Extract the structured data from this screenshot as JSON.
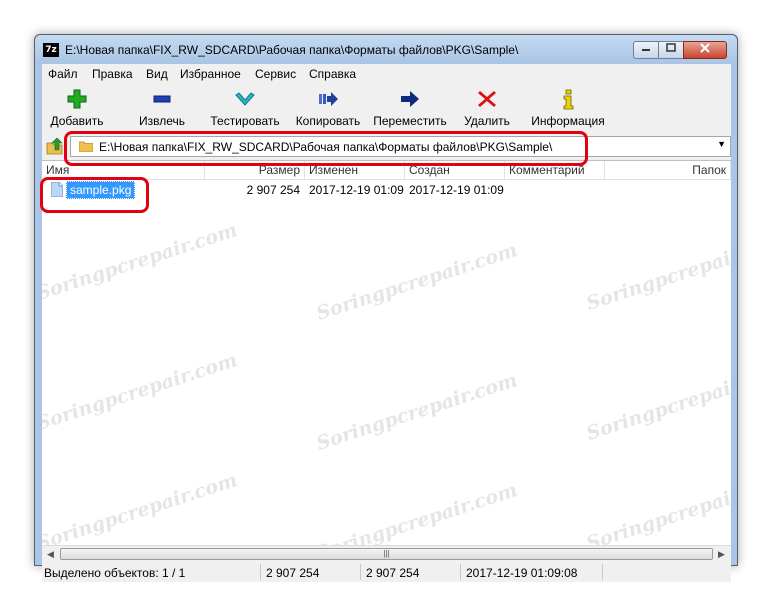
{
  "window": {
    "title": "E:\\Новая папка\\FIX_RW_SDCARD\\Рабочая папка\\Форматы файлов\\PKG\\Sample\\",
    "app_icon": "7z"
  },
  "menu": [
    "Файл",
    "Правка",
    "Вид",
    "Избранное",
    "Сервис",
    "Справка"
  ],
  "toolbar": [
    {
      "label": "Добавить",
      "icon": "plus-icon",
      "color": "#22aa22"
    },
    {
      "label": "Извлечь",
      "icon": "minus-icon",
      "color": "#1f3fb4"
    },
    {
      "label": "Тестировать",
      "icon": "check-icon",
      "color": "#22b8c8"
    },
    {
      "label": "Копировать",
      "icon": "copy-arrow-icon",
      "color": "#1f3f9a"
    },
    {
      "label": "Переместить",
      "icon": "arrow-right-icon",
      "color": "#0d2a80"
    },
    {
      "label": "Удалить",
      "icon": "x-icon",
      "color": "#dd1111"
    },
    {
      "label": "Информация",
      "icon": "info-icon",
      "color": "#e8d400"
    }
  ],
  "address": {
    "path": "E:\\Новая папка\\FIX_RW_SDCARD\\Рабочая папка\\Форматы файлов\\PKG\\Sample\\"
  },
  "columns": [
    "Имя",
    "Размер",
    "Изменен",
    "Создан",
    "Комментарий",
    "Папок"
  ],
  "rows": [
    {
      "name": "sample.pkg",
      "size": "2 907 254",
      "modified": "2017-12-19 01:09",
      "created": "2017-12-19 01:09",
      "comment": "",
      "folders": ""
    }
  ],
  "status": {
    "selected": "Выделено объектов: 1 / 1",
    "size1": "2 907 254",
    "size2": "2 907 254",
    "datetime": "2017-12-19 01:09:08"
  },
  "watermark": "Soringpcrepair.com",
  "accent": "#e3000f"
}
